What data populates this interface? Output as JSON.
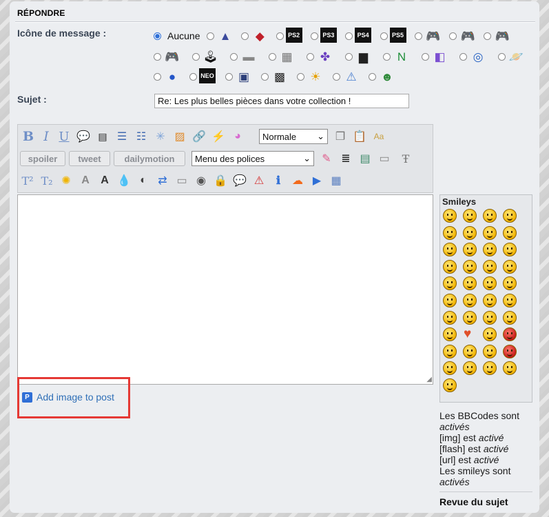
{
  "section": {
    "title": "RÉPONDRE"
  },
  "form": {
    "icon_label": "Icône de message :",
    "none_label": "Aucune",
    "subject_label": "Sujet :",
    "subject_value": "Re: Les plus belles pièces dans votre collection !"
  },
  "icons_row1": [
    {
      "name": "triangle-logo-icon",
      "glyph": "▲",
      "color": "#3b4a9c"
    },
    {
      "name": "playstation-icon",
      "glyph": "◆",
      "color": "#c0202a"
    },
    {
      "name": "ps2-icon",
      "glyph": "PS2",
      "color": "#2d5fc4"
    },
    {
      "name": "ps3-icon",
      "glyph": "PS3",
      "color": "#222"
    },
    {
      "name": "ps4-icon",
      "glyph": "PS4",
      "color": "#222"
    },
    {
      "name": "ps5-icon",
      "glyph": "PS5",
      "color": "#222"
    },
    {
      "name": "gamepad-1-icon",
      "glyph": "🎮",
      "color": "#111"
    },
    {
      "name": "gamepad-2-icon",
      "glyph": "🎮",
      "color": "#111"
    },
    {
      "name": "gamepad-3-icon",
      "glyph": "🎮",
      "color": "#111"
    }
  ],
  "icons_row2": [
    {
      "name": "gamepad-4-icon",
      "glyph": "🎮",
      "color": "#111"
    },
    {
      "name": "gamepad-5-icon",
      "glyph": "🕹",
      "color": "#111"
    },
    {
      "name": "nes-console-icon",
      "glyph": "▬",
      "color": "#888"
    },
    {
      "name": "snes-console-icon",
      "glyph": "▦",
      "color": "#777"
    },
    {
      "name": "snes-buttons-icon",
      "glyph": "✤",
      "color": "#6a3fc0"
    },
    {
      "name": "n64-console-icon",
      "glyph": "▆",
      "color": "#222"
    },
    {
      "name": "n64-logo-icon",
      "glyph": "N",
      "color": "#1f8f3a"
    },
    {
      "name": "gamecube-icon",
      "glyph": "◧",
      "color": "#7b4fd1"
    },
    {
      "name": "dreamcast-icon",
      "glyph": "◎",
      "color": "#2a64c4"
    },
    {
      "name": "saturn-planet-icon",
      "glyph": "🪐",
      "color": "#2c4fb8"
    }
  ],
  "icons_row3": [
    {
      "name": "sonic-icon",
      "glyph": "●",
      "color": "#2456c8"
    },
    {
      "name": "neogeo-icon",
      "glyph": "NEO",
      "color": "#1f5fbf"
    },
    {
      "name": "cartridge-icon",
      "glyph": "▣",
      "color": "#2c3f7a"
    },
    {
      "name": "chip-icon",
      "glyph": "▩",
      "color": "#222"
    },
    {
      "name": "lightbulb-icon",
      "glyph": "☀",
      "color": "#e6a100"
    },
    {
      "name": "warning-icon",
      "glyph": "⚠",
      "color": "#4a7fd0"
    },
    {
      "name": "grin-icon",
      "glyph": "☻",
      "color": "#2f8a3a"
    }
  ],
  "toolbar": {
    "size_select": "Normale",
    "font_select": "Menu des polices",
    "spoiler": "spoiler",
    "tweet": "tweet",
    "dailymotion": "dailymotion"
  },
  "add_image": "Add image to post",
  "smileys": {
    "title": "Smileys",
    "count": 41
  },
  "bbcode": {
    "les": "Les",
    "bbcodes": "BBCodes",
    "sont": "sont",
    "actives": "activés",
    "img": "[img] est",
    "flash": "[flash] est",
    "url": "[url] est",
    "active": "activé",
    "smileys_line": "Les smileys sont",
    "smileys_state": "activés"
  },
  "review": "Revue du sujet"
}
